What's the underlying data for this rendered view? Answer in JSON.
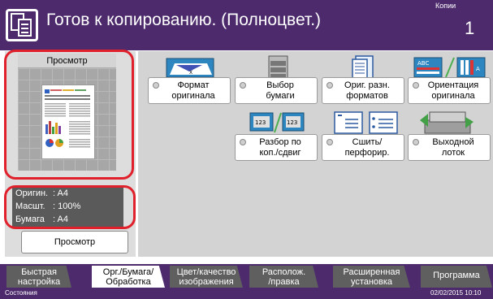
{
  "header": {
    "title": "Готов к копированию. (Полноцвет.)",
    "copies_label": "Копии",
    "copies_value": "1",
    "icon": "copy-icon"
  },
  "preview": {
    "title": "Просмотр",
    "info": [
      {
        "key": "Оригин.",
        "value": ": A4"
      },
      {
        "key": "Масшт.",
        "value": ": 100%"
      },
      {
        "key": "Бумага",
        "value": ": A4"
      }
    ],
    "button_label": "Просмотр",
    "ring_color": "#e0202a"
  },
  "functions": [
    {
      "label_line1": "Формат",
      "label_line2": "оригинала",
      "icon": "original-size-icon"
    },
    {
      "label_line1": "Выбор",
      "label_line2": "бумаги",
      "icon": "paper-selection-icon"
    },
    {
      "label_line1": "Ориг. разн.",
      "label_line2": "форматов",
      "icon": "mixed-size-originals-icon"
    },
    {
      "label_line1": "Ориентация",
      "label_line2": "оригинала",
      "icon": "original-orientation-icon"
    },
    {
      "label_line1": "Разбор по",
      "label_line2": "коп./сдвиг",
      "icon": "collate-offset-icon"
    },
    {
      "label_line1": "Сшить/",
      "label_line2": "перфорир.",
      "icon": "staple-punch-icon"
    },
    {
      "label_line1": "Выходной",
      "label_line2": "лоток",
      "icon": "output-tray-icon"
    }
  ],
  "tabs": [
    {
      "line1": "Быстрая",
      "line2": "настройка",
      "active": false
    },
    {
      "line1": "Орг./Бумага/",
      "line2": "Обработка",
      "active": true
    },
    {
      "line1": "Цвет/качество",
      "line2": "изображения",
      "active": false
    },
    {
      "line1": "Располож.",
      "line2": "/правка",
      "active": false
    },
    {
      "line1": "Расширенная",
      "line2": "установка",
      "active": false
    },
    {
      "line1": "Программа",
      "line2": "",
      "active": false
    }
  ],
  "status": {
    "label": "Состояния",
    "datetime": "02/02/2015 10:10"
  },
  "colors": {
    "header": "#4d2a6c",
    "panel": "#d3d3d3",
    "tab_inactive": "#5f5f5f"
  }
}
